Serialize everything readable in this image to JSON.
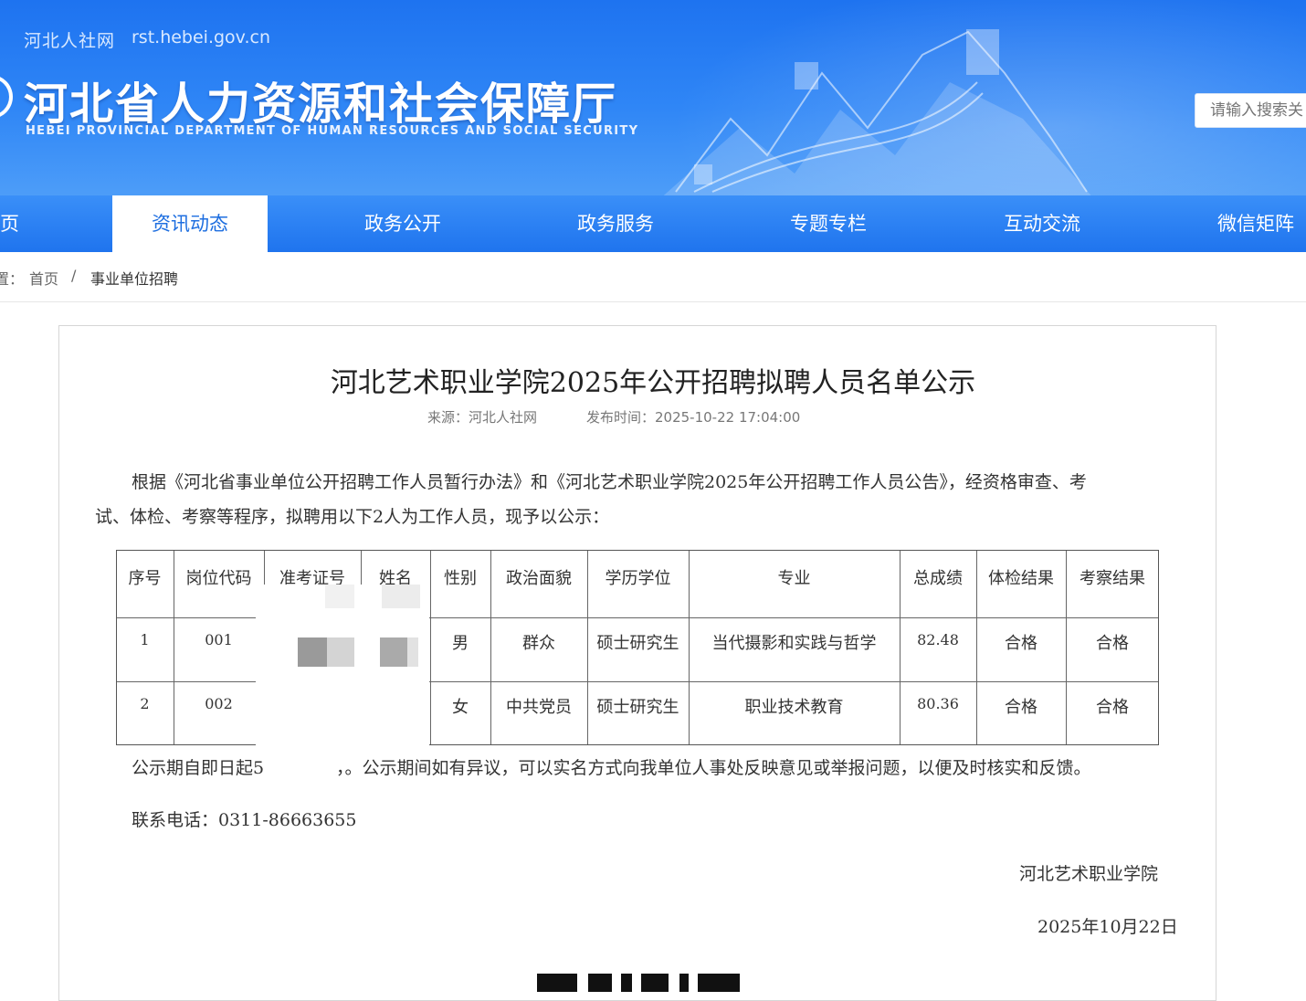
{
  "header": {
    "site_name": "河北人社网",
    "site_url": "rst.hebei.gov.cn",
    "title_cn": "河北省人力资源和社会保障厅",
    "title_en": "HEBEI PROVINCIAL DEPARTMENT OF HUMAN RESOURCES AND SOCIAL SECURITY",
    "search_placeholder": "请输入搜索关",
    "brand_color": "#1f74ee"
  },
  "nav": {
    "items": [
      {
        "label": "页"
      },
      {
        "label": "资讯动态",
        "active": true
      },
      {
        "label": "政务公开"
      },
      {
        "label": "政务服务"
      },
      {
        "label": "专题专栏"
      },
      {
        "label": "互动交流"
      },
      {
        "label": "微信矩阵"
      }
    ]
  },
  "breadcrumb": {
    "prefix": "置：",
    "home": "首页",
    "separator": "/",
    "current": "事业单位招聘"
  },
  "article": {
    "title": "河北艺术职业学院2025年公开招聘拟聘人员名单公示",
    "source": "来源：河北人社网",
    "publish_time": "发布时间：2025-10-22 17:04:00",
    "intro_line1": "根据《河北省事业单位公开招聘工作人员暂行办法》和《河北艺术职业学院2025年公开招聘工作人员公告》，经资格审查、考",
    "intro_line2": "试、体检、考察等程序，拟聘用以下2人为工作人员，现予以公示：",
    "notice_start": "公示期自即日起5",
    "notice_end": "，。公示期间如有异议，可以实名方式向我单位人事处反映意见或举报问题，以便及时核实和反馈。",
    "contact": "联系电话：0311-86663655",
    "signature": "河北艺术职业学院",
    "date": "2025年10月22日"
  },
  "table": {
    "headers": [
      "序号",
      "岗位代码",
      "准考证号",
      "姓名",
      "性别",
      "政治面貌",
      "学历学位",
      "专业",
      "总成绩",
      "体检结果",
      "考察结果"
    ],
    "rows": [
      {
        "seq": "1",
        "code": "001",
        "gender": "男",
        "political": "群众",
        "degree": "硕士研究生",
        "major": "当代摄影和实践与哲学",
        "score": "82.48",
        "physical": "合格",
        "review": "合格"
      },
      {
        "seq": "2",
        "code": "002",
        "gender": "女",
        "political": "中共党员",
        "degree": "硕士研究生",
        "major": "职业技术教育",
        "score": "80.36",
        "physical": "合格",
        "review": "合格"
      }
    ]
  }
}
